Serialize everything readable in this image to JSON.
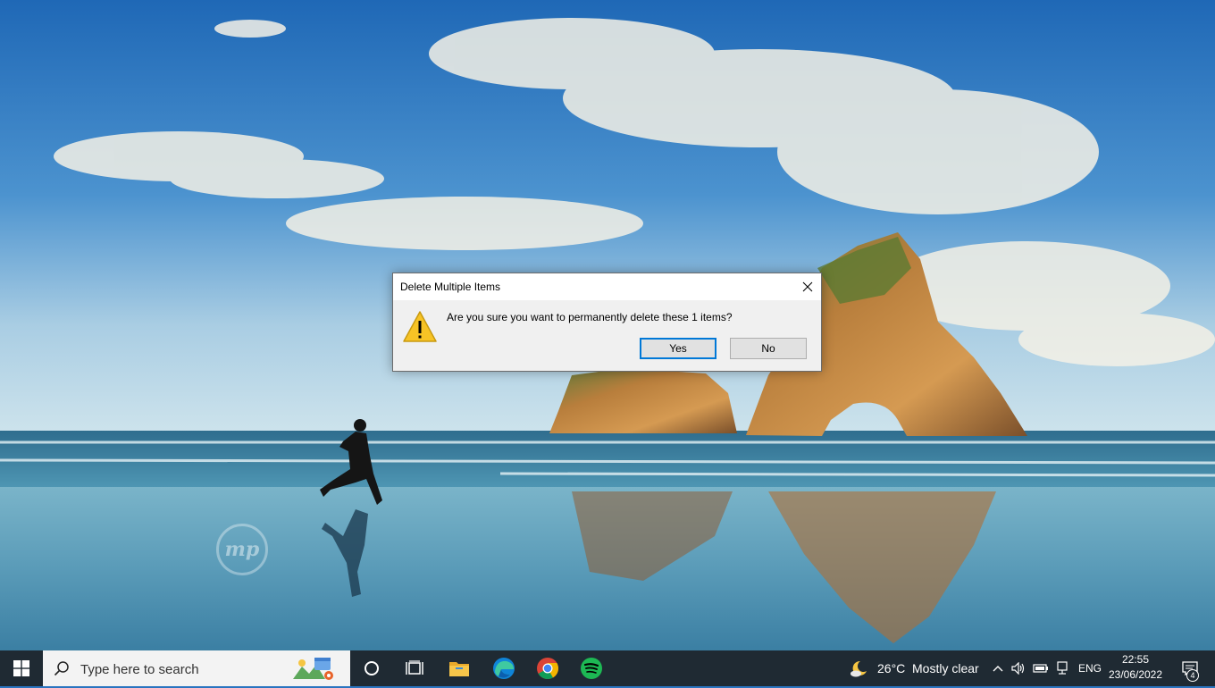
{
  "dialog": {
    "title": "Delete Multiple Items",
    "message": "Are you sure you want to permanently delete these 1 items?",
    "yes_label": "Yes",
    "no_label": "No"
  },
  "desktop": {
    "watermark_text": "mp"
  },
  "taskbar": {
    "search_placeholder": "Type here to search",
    "pinned_apps": [
      "cortana",
      "task-view",
      "file-explorer",
      "edge",
      "chrome",
      "spotify"
    ],
    "weather": {
      "temperature": "26°C",
      "condition": "Mostly clear"
    },
    "language": "ENG",
    "time": "22:55",
    "date": "23/06/2022",
    "notification_count": "4"
  },
  "colors": {
    "taskbar_bg": "#1f2a33",
    "accent": "#0078d7",
    "warning_yellow": "#f7c325"
  }
}
